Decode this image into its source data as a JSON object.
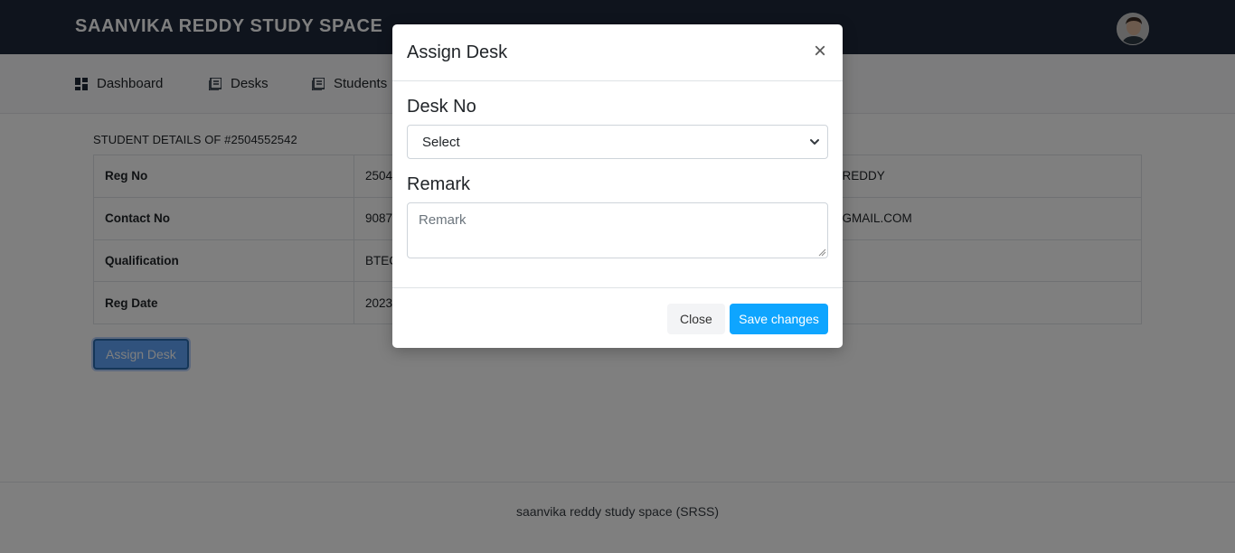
{
  "header": {
    "brand": "SAANVIKA REDDY STUDY SPACE",
    "avatar_icon": "user-avatar"
  },
  "nav": {
    "items": [
      {
        "label": "Dashboard",
        "icon": "dashboard-icon"
      },
      {
        "label": "Desks",
        "icon": "list-icon"
      },
      {
        "label": "Students",
        "icon": "list-icon"
      }
    ]
  },
  "details": {
    "title": "STUDENT DETAILS OF #2504552542",
    "rows": [
      {
        "label": "Reg No",
        "value": "2504",
        "value2": "REDDY"
      },
      {
        "label": "Contact No",
        "value": "9087",
        "value2": "GMAIL.COM"
      },
      {
        "label": "Qualification",
        "value": "BTEC",
        "value2": ""
      },
      {
        "label": "Reg Date",
        "value": "2023",
        "value2": ""
      }
    ],
    "assign_button": "Assign Desk"
  },
  "footer": {
    "text": "saanvika reddy study space (SRSS)"
  },
  "modal": {
    "title": "Assign Desk",
    "close_symbol": "×",
    "desk_label": "Desk No",
    "desk_select_value": "Select",
    "remark_label": "Remark",
    "remark_placeholder": "Remark",
    "close_button": "Close",
    "save_button": "Save changes"
  },
  "colors": {
    "topbar": "#1e293b",
    "primary": "#0ea5ff",
    "backdrop": "rgba(0,0,0,0.5)"
  }
}
